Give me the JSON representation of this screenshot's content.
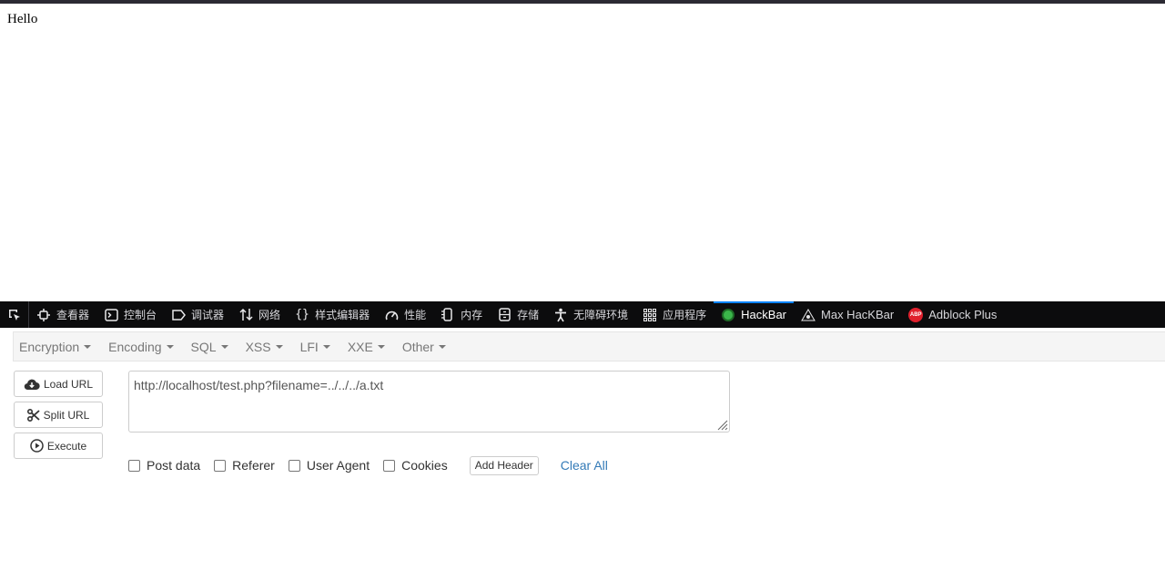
{
  "page": {
    "body_text": "Hello"
  },
  "devtools": {
    "tabs": [
      {
        "label": "查看器",
        "icon": "inspector-icon"
      },
      {
        "label": "控制台",
        "icon": "console-icon"
      },
      {
        "label": "调试器",
        "icon": "debugger-icon"
      },
      {
        "label": "网络",
        "icon": "network-icon"
      },
      {
        "label": "样式编辑器",
        "icon": "style-editor-icon"
      },
      {
        "label": "性能",
        "icon": "performance-icon"
      },
      {
        "label": "内存",
        "icon": "memory-icon"
      },
      {
        "label": "存储",
        "icon": "storage-icon"
      },
      {
        "label": "无障碍环境",
        "icon": "accessibility-icon"
      },
      {
        "label": "应用程序",
        "icon": "application-icon"
      }
    ],
    "extensions": [
      {
        "label": "HackBar",
        "selected": true
      },
      {
        "label": "Max HacKBar"
      },
      {
        "label": "Adblock Plus",
        "badge": "ABP"
      }
    ]
  },
  "hackbar": {
    "menu": [
      "Encryption",
      "Encoding",
      "SQL",
      "XSS",
      "LFI",
      "XXE",
      "Other"
    ],
    "buttons": {
      "load_url": "Load URL",
      "split_url": "Split URL",
      "execute": "Execute"
    },
    "url_value": "http://localhost/test.php?filename=../../../a.txt",
    "options": [
      "Post data",
      "Referer",
      "User Agent",
      "Cookies"
    ],
    "add_header": "Add Header",
    "clear_all": "Clear All"
  },
  "colors": {
    "devtools_bg": "#0c0c0d",
    "tab_highlight": "#0a84ff",
    "link": "#337ab7"
  }
}
